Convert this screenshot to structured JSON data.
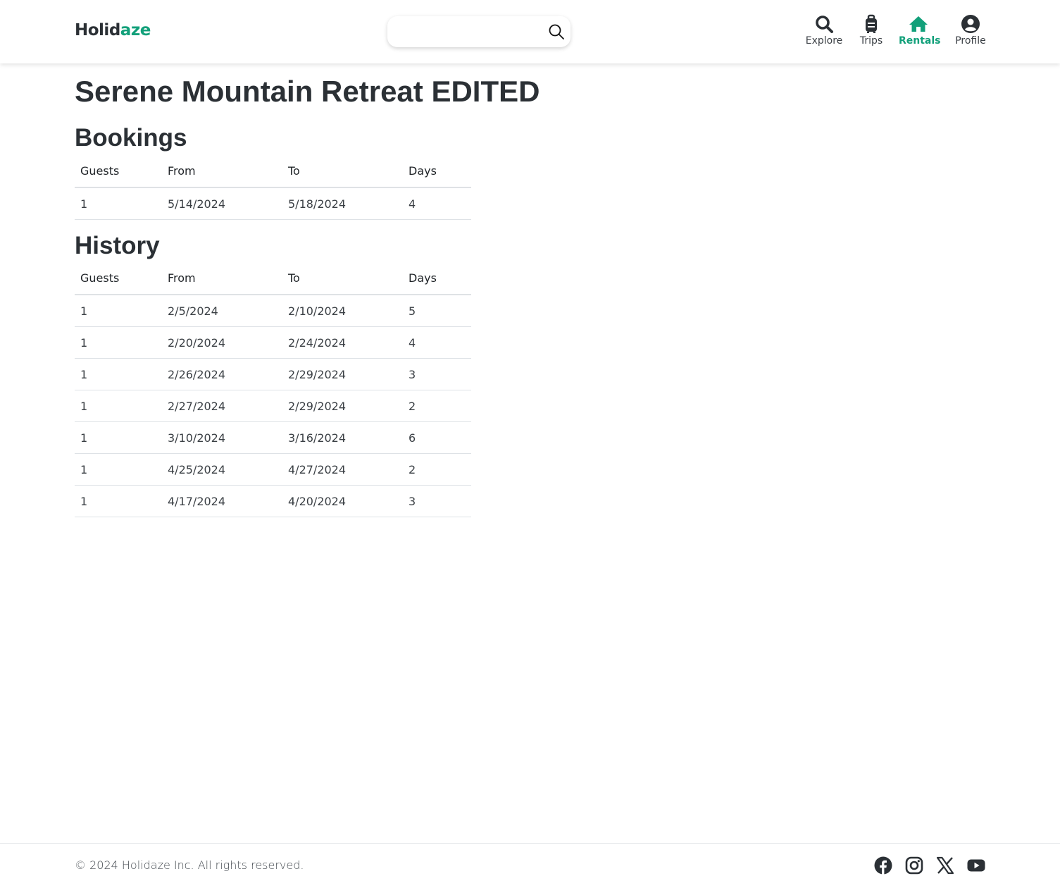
{
  "header": {
    "logo_main": "Holid",
    "logo_accent": "aze",
    "search": {
      "value": "",
      "placeholder": ""
    },
    "nav": [
      {
        "label": "Explore",
        "icon": "search-icon",
        "active": false
      },
      {
        "label": "Trips",
        "icon": "suitcase-icon",
        "active": false
      },
      {
        "label": "Rentals",
        "icon": "house-icon",
        "active": true
      },
      {
        "label": "Profile",
        "icon": "user-circle-icon",
        "active": false
      }
    ],
    "accent_color": "#12a07a"
  },
  "main": {
    "title": "Serene Mountain Retreat EDITED",
    "bookings": {
      "heading": "Bookings",
      "columns": [
        "Guests",
        "From",
        "To",
        "Days"
      ],
      "rows": [
        [
          "1",
          "5/14/2024",
          "5/18/2024",
          "4"
        ]
      ]
    },
    "history": {
      "heading": "History",
      "columns": [
        "Guests",
        "From",
        "To",
        "Days"
      ],
      "rows": [
        [
          "1",
          "2/5/2024",
          "2/10/2024",
          "5"
        ],
        [
          "1",
          "2/20/2024",
          "2/24/2024",
          "4"
        ],
        [
          "1",
          "2/26/2024",
          "2/29/2024",
          "3"
        ],
        [
          "1",
          "2/27/2024",
          "2/29/2024",
          "2"
        ],
        [
          "1",
          "3/10/2024",
          "3/16/2024",
          "6"
        ],
        [
          "1",
          "4/25/2024",
          "4/27/2024",
          "2"
        ],
        [
          "1",
          "4/17/2024",
          "4/20/2024",
          "3"
        ]
      ]
    }
  },
  "footer": {
    "copyright": "© 2024 Holidaze Inc. All rights reserved.",
    "social": [
      "facebook-icon",
      "instagram-icon",
      "x-icon",
      "youtube-icon"
    ]
  }
}
